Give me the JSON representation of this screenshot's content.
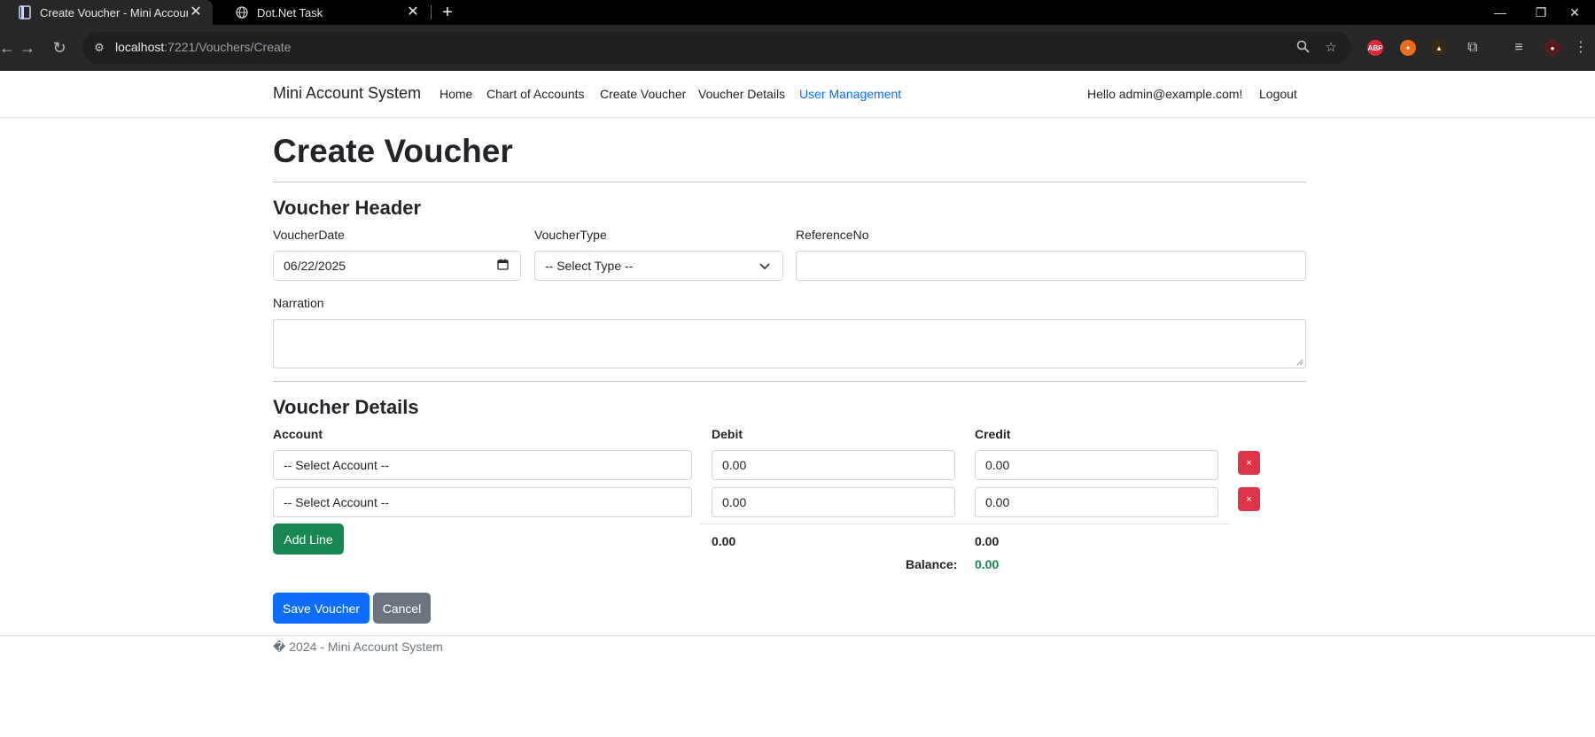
{
  "browser": {
    "tabs": [
      {
        "title": "Create Voucher - Mini Account",
        "active": true
      },
      {
        "title": "Dot.Net Task",
        "active": false
      }
    ],
    "url_host": "localhost",
    "url_path": ":7221/Vouchers/Create",
    "extension_abp_label": "ABP"
  },
  "navbar": {
    "brand": "Mini Account System",
    "links": [
      "Home",
      "Chart of Accounts",
      "Create Voucher",
      "Voucher Details",
      "User Management"
    ],
    "greeting": "Hello admin@example.com!",
    "logout": "Logout"
  },
  "page": {
    "title": "Create Voucher",
    "header_section": "Voucher Header",
    "voucher_date_label": "VoucherDate",
    "voucher_date_value": "06/22/2025",
    "voucher_type_label": "VoucherType",
    "voucher_type_value": "-- Select Type --",
    "reference_label": "ReferenceNo",
    "reference_value": "",
    "narration_label": "Narration",
    "narration_value": "",
    "details_section": "Voucher Details",
    "columns": {
      "account": "Account",
      "debit": "Debit",
      "credit": "Credit"
    },
    "lines": [
      {
        "account": "-- Select Account --",
        "debit": "0.00",
        "credit": "0.00",
        "remove": "×"
      },
      {
        "account": "-- Select Account --",
        "debit": "0.00",
        "credit": "0.00",
        "remove": "×"
      }
    ],
    "add_line": "Add Line",
    "total_debit": "0.00",
    "total_credit": "0.00",
    "balance_label": "Balance:",
    "balance_value": "0.00",
    "save": "Save Voucher",
    "cancel": "Cancel"
  },
  "footer": {
    "text": "� 2024 - Mini Account System"
  },
  "colors": {
    "primary": "#0d6efd",
    "success": "#198754",
    "danger": "#dc3545",
    "secondary": "#6c757d"
  }
}
